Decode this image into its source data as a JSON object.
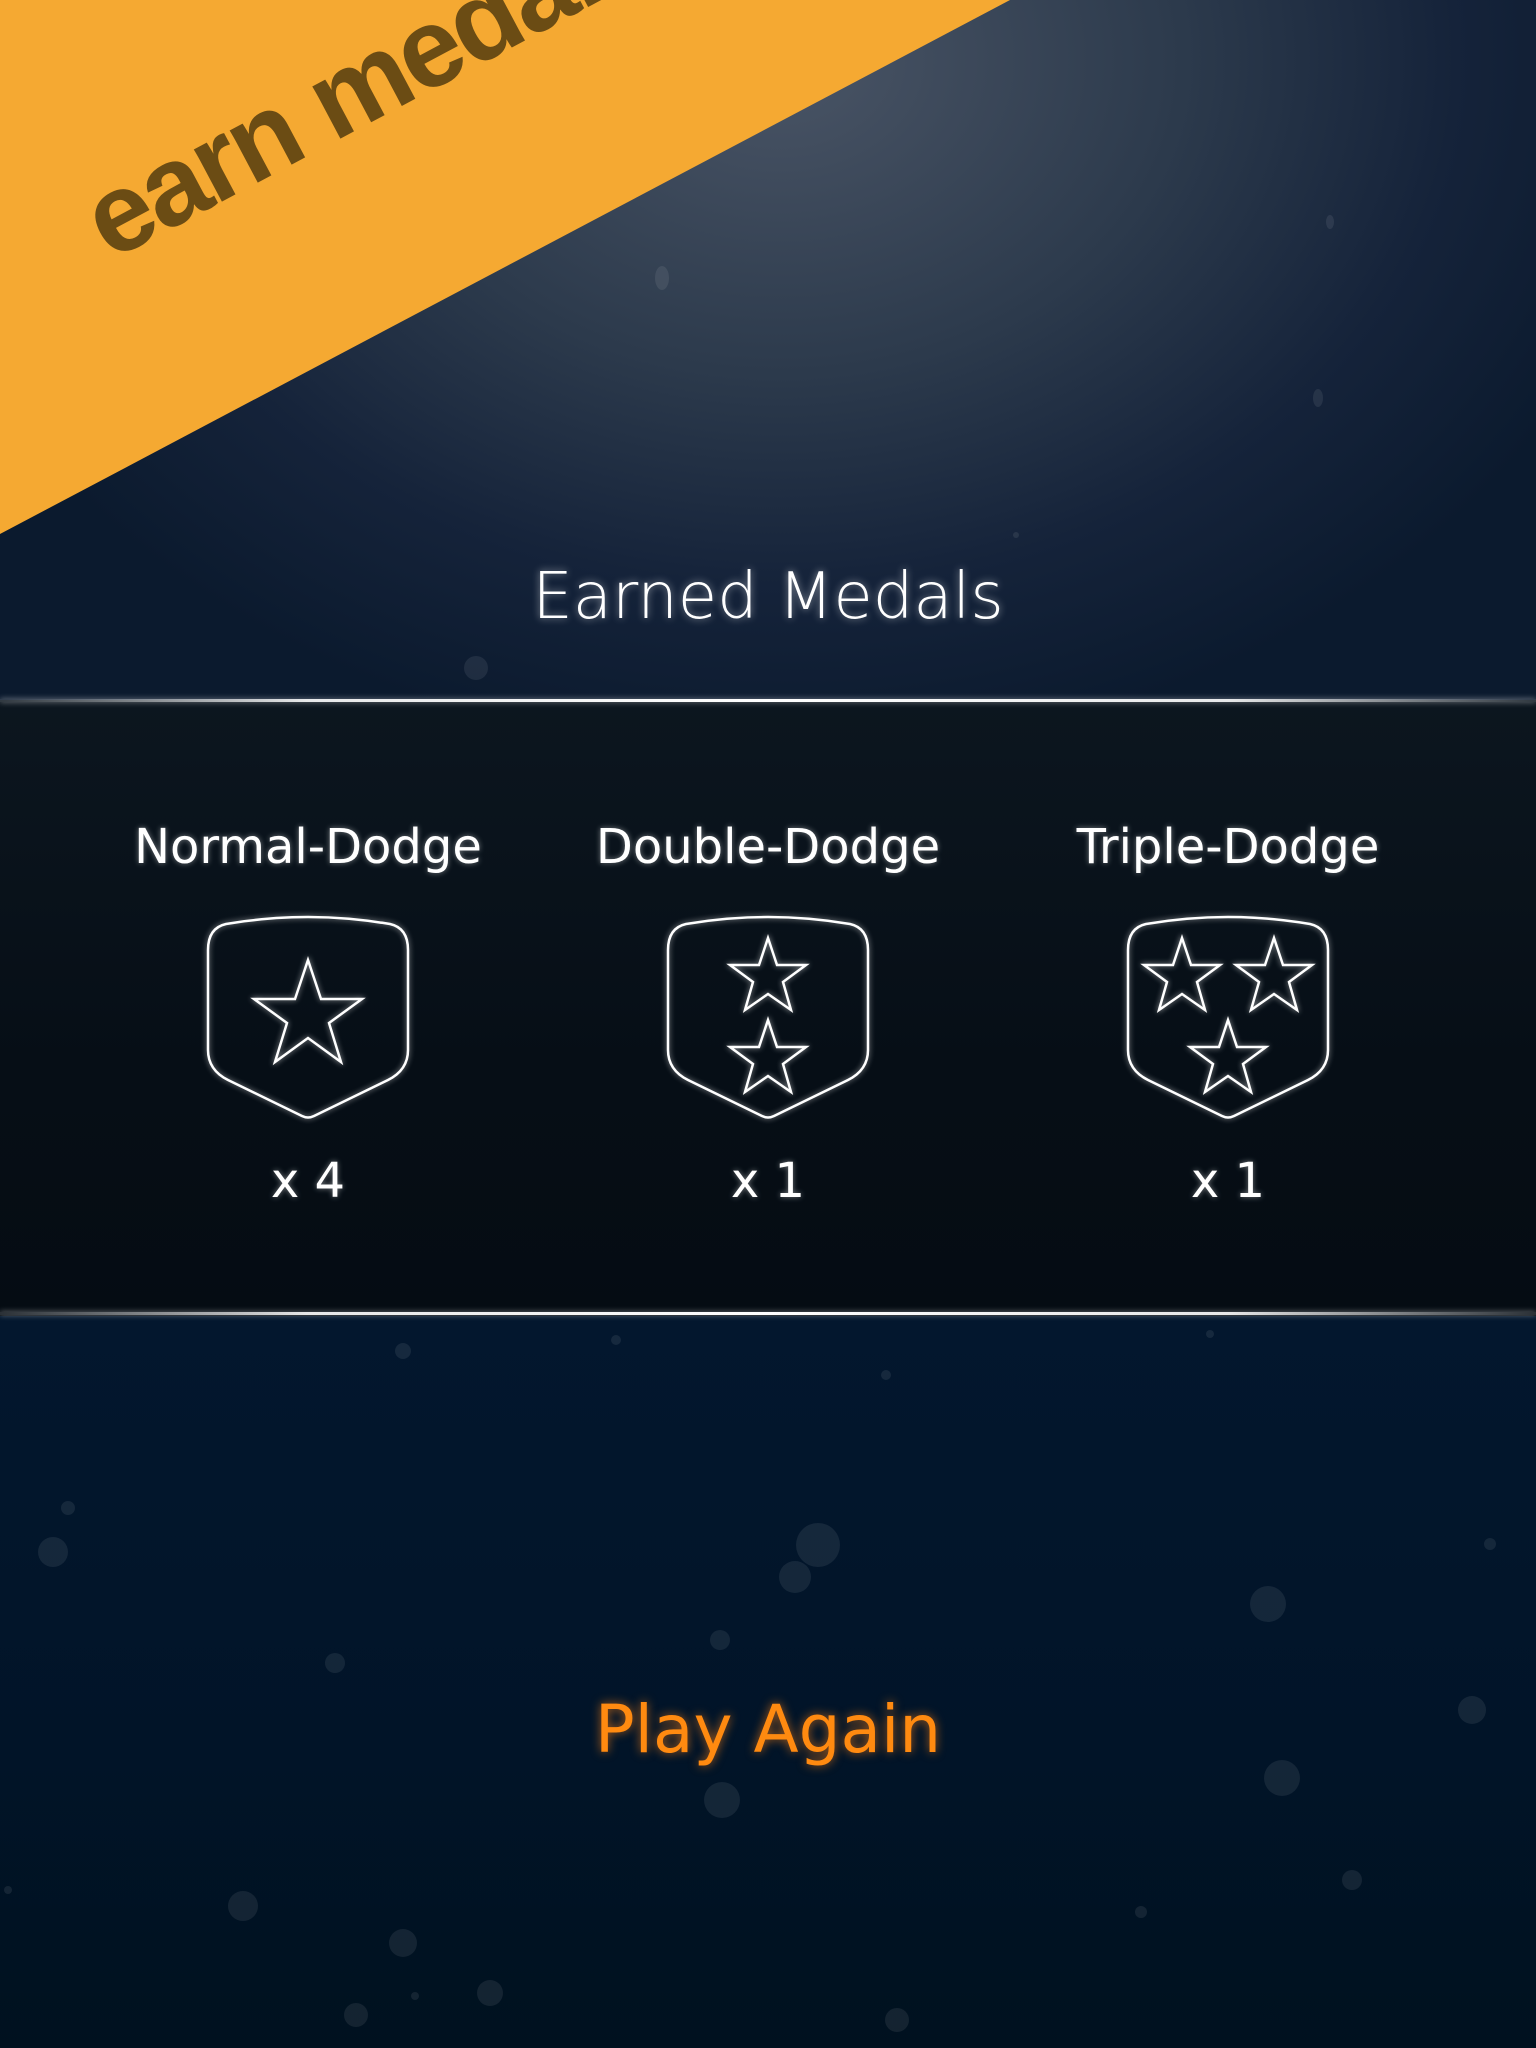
{
  "banner": {
    "text": "earn medals",
    "color": "#f5a932",
    "text_color": "#6b4c14"
  },
  "screen": {
    "title": "Earned Medals"
  },
  "medals": [
    {
      "name": "Normal-Dodge",
      "count": "x 4",
      "stars": 1,
      "icon": "shield-one-star-icon"
    },
    {
      "name": "Double-Dodge",
      "count": "x 1",
      "stars": 2,
      "icon": "shield-two-stars-icon"
    },
    {
      "name": "Triple-Dodge",
      "count": "x 1",
      "stars": 3,
      "icon": "shield-three-stars-icon"
    }
  ],
  "actions": {
    "play_again_label": "Play Again",
    "accent_color": "#ff8a10"
  }
}
